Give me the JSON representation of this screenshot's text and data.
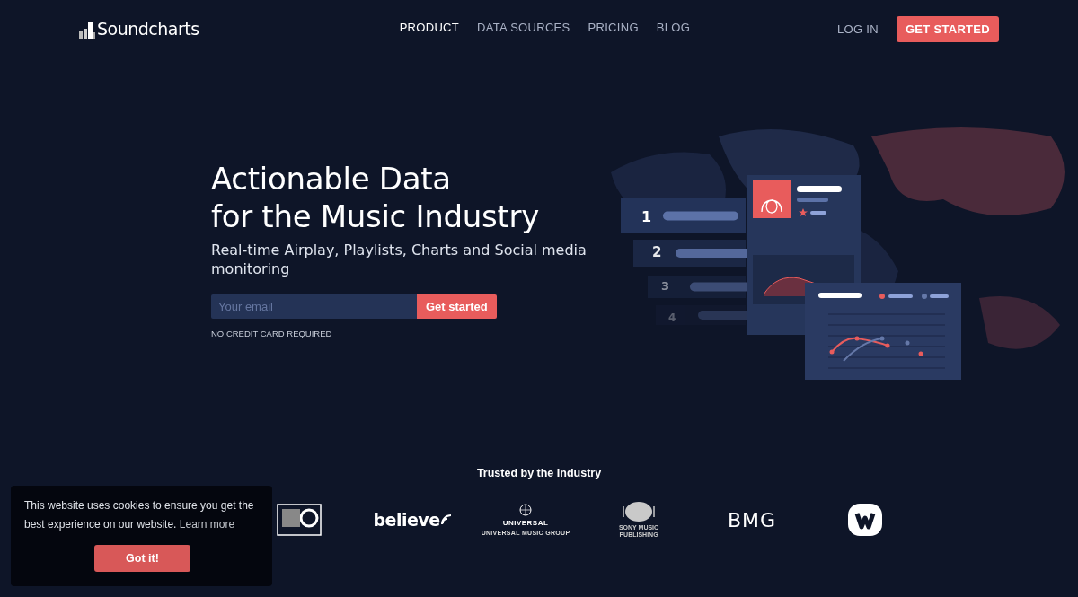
{
  "brand": {
    "name": "Soundcharts"
  },
  "nav": [
    {
      "label": "PRODUCT",
      "selected": true
    },
    {
      "label": "DATA SOURCES",
      "selected": false
    },
    {
      "label": "PRICING",
      "selected": false
    },
    {
      "label": "BLOG",
      "selected": false
    }
  ],
  "login": "LOG IN",
  "cta": "GET STARTED",
  "hero": {
    "title_lines": [
      "Actionable Data",
      "for the Music Industry"
    ],
    "subtitle": "Real-time Airplay, Playlists, Charts and Social media monitoring",
    "email": {
      "placeholder": "Your email"
    },
    "button": "Get started",
    "note": "NO CREDIT CARD REQUIRED"
  },
  "illustration": {
    "ranks": [
      "1",
      "2",
      "3",
      "4"
    ]
  },
  "trusted": {
    "title": "Trusted by the Industry",
    "logos": [
      {
        "kind": "atlantic"
      },
      {
        "kind": "believe",
        "text": "believe"
      },
      {
        "kind": "universal",
        "text": "UNIVERSAL",
        "subtext": "UNIVERSAL MUSIC GROUP"
      },
      {
        "kind": "sony",
        "subtext": "SONY MUSIC PUBLISHING"
      },
      {
        "kind": "bmg",
        "text": "BMG"
      },
      {
        "kind": "warner"
      }
    ]
  },
  "cookie": {
    "message": "This website uses cookies to ensure you get the best experience on our website.",
    "link": "Learn more",
    "button": "Got it!"
  }
}
